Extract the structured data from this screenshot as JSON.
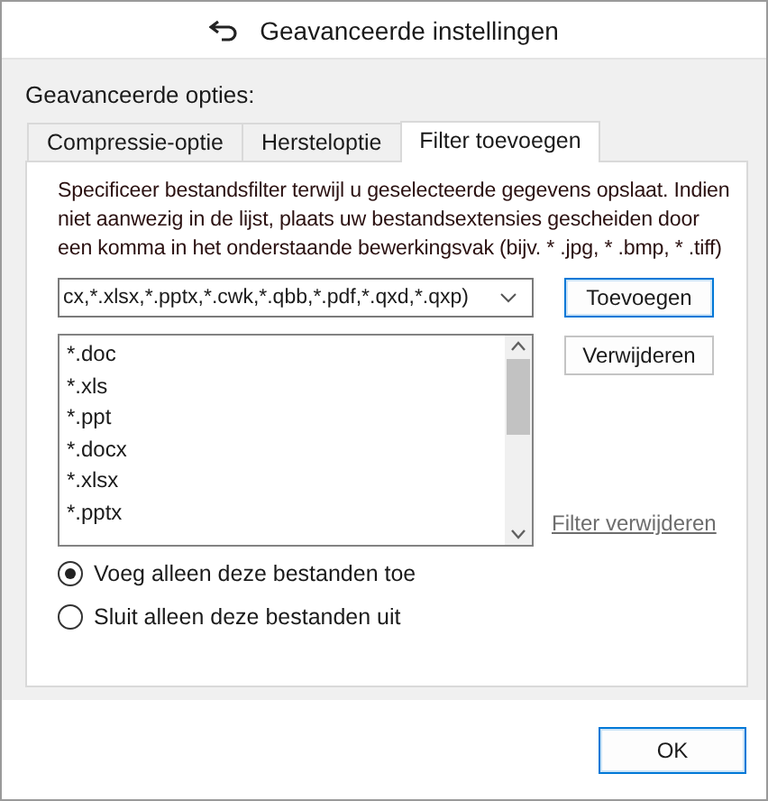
{
  "window": {
    "title": "Geavanceerde instellingen"
  },
  "heading": "Geavanceerde opties:",
  "tabs": [
    {
      "label": "Compressie-optie",
      "selected": false
    },
    {
      "label": "Hersteloptie",
      "selected": false
    },
    {
      "label": "Filter toevoegen",
      "selected": true
    }
  ],
  "description": "Specificeer bestandsfilter terwijl u geselecteerde gegevens opslaat. Indien niet aanwezig in de lijst, plaats uw bestandsextensies gescheiden door een komma in het onderstaande bewerkingsvak (bijv. * .jpg, * .bmp, * .tiff)",
  "filter_field": {
    "value": "cx,*.xlsx,*.pptx,*.cwk,*.qbb,*.pdf,*.qxd,*.qxp)"
  },
  "add_button": "Toevoegen",
  "remove_button": "Verwijderen",
  "extensions": [
    "*.doc",
    "*.xls",
    "*.ppt",
    "*.docx",
    "*.xlsx",
    "*.pptx"
  ],
  "remove_filter_link": "Filter verwijderen",
  "mode_options": [
    {
      "label": "Voeg alleen deze bestanden toe",
      "selected": true
    },
    {
      "label": "Sluit alleen deze bestanden uit",
      "selected": false
    }
  ],
  "ok_button": "OK"
}
